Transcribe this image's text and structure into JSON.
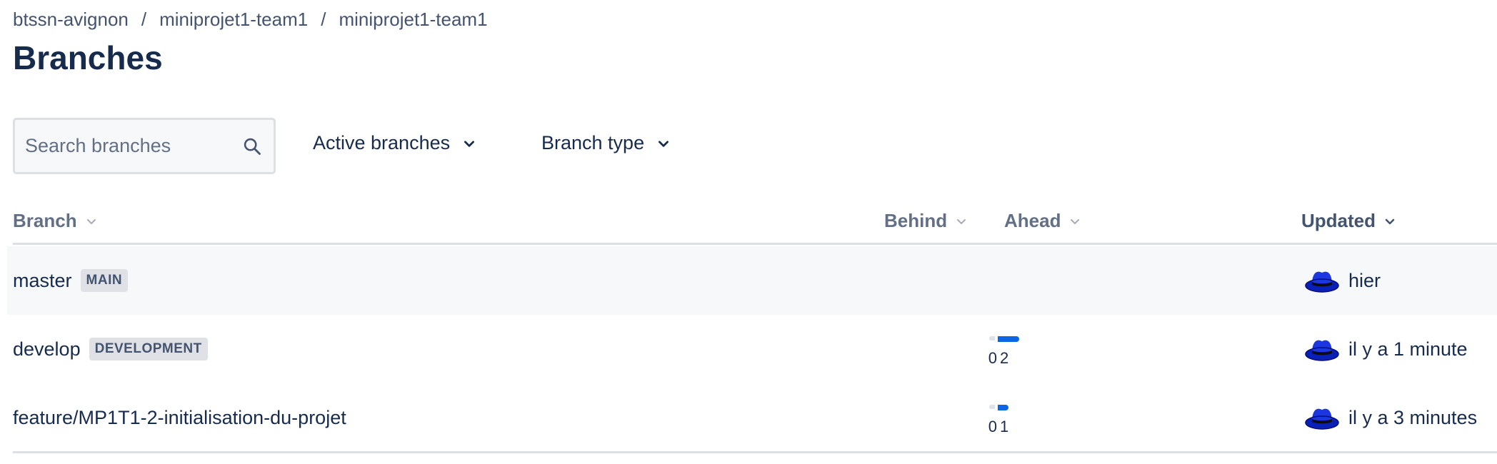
{
  "breadcrumb": {
    "items": [
      "btssn-avignon",
      "miniprojet1-team1",
      "miniprojet1-team1"
    ],
    "separator": "/"
  },
  "page": {
    "title": "Branches"
  },
  "search": {
    "placeholder": "Search branches",
    "value": "",
    "icon": "search-icon"
  },
  "filters": {
    "active": {
      "label": "Active branches",
      "icon": "chevron-down-icon"
    },
    "type": {
      "label": "Branch type",
      "icon": "chevron-down-icon"
    }
  },
  "table": {
    "columns": {
      "branch": "Branch",
      "behind": "Behind",
      "ahead": "Ahead",
      "updated": "Updated"
    },
    "rows": [
      {
        "name": "master",
        "badge": "MAIN",
        "behind": null,
        "ahead": null,
        "updated": "hier",
        "avatar": "hat-avatar-icon"
      },
      {
        "name": "develop",
        "badge": "DEVELOPMENT",
        "behind": "0",
        "ahead": "2",
        "ahead_ratio": 1.0,
        "updated": "il y a 1 minute",
        "avatar": "hat-avatar-icon"
      },
      {
        "name": "feature/MP1T1-2-initialisation-du-projet",
        "badge": "",
        "behind": "0",
        "ahead": "1",
        "ahead_ratio": 0.5,
        "updated": "il y a 3 minutes",
        "avatar": "hat-avatar-icon"
      }
    ]
  },
  "colors": {
    "accent": "#0c66e4",
    "text": "#172b4d",
    "subtle": "#626f86",
    "lozenge_bg": "#dfe1e6"
  }
}
